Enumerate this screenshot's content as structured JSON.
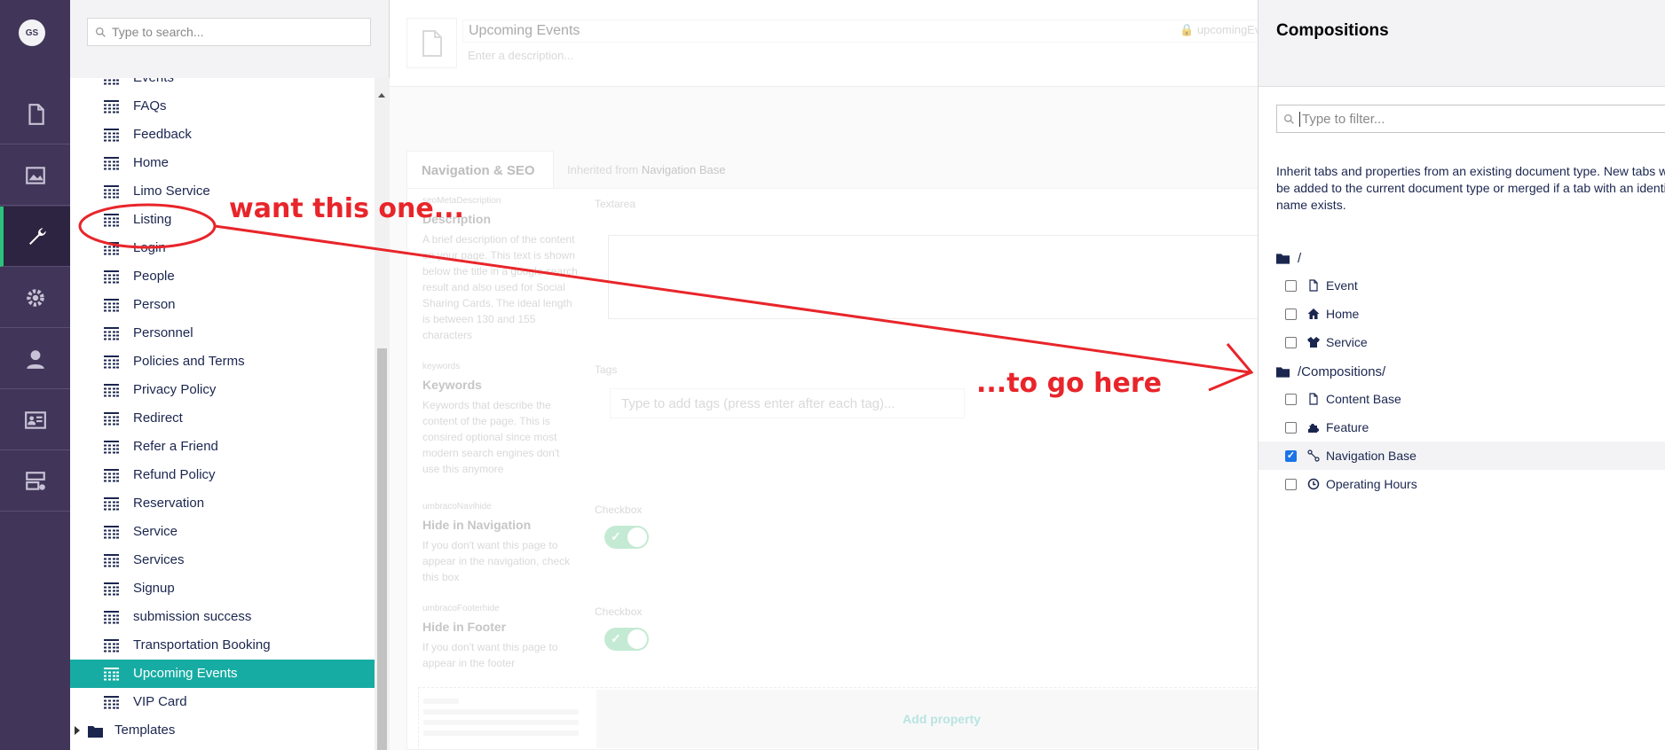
{
  "rail": {
    "avatar_initials": "GS",
    "sections": [
      {
        "name": "content",
        "icon": "document-icon"
      },
      {
        "name": "media",
        "icon": "image-icon"
      },
      {
        "name": "settings",
        "icon": "wrench-icon",
        "active": true
      },
      {
        "name": "packages",
        "icon": "gear-icon"
      },
      {
        "name": "users",
        "icon": "user-icon"
      },
      {
        "name": "members",
        "icon": "id-card-icon"
      },
      {
        "name": "forms",
        "icon": "form-icon"
      }
    ]
  },
  "tree": {
    "search_placeholder": "Type to search...",
    "partial_item": "Events",
    "items": [
      "FAQs",
      "Feedback",
      "Home",
      "Limo Service",
      "Listing",
      "Login",
      "People",
      "Person",
      "Personnel",
      "Policies and Terms",
      "Privacy Policy",
      "Redirect",
      "Refer a Friend",
      "Refund Policy",
      "Reservation",
      "Service",
      "Services",
      "Signup",
      "submission success",
      "Transportation Booking",
      "Upcoming Events",
      "VIP Card"
    ],
    "selected": "Upcoming Events",
    "folder": "Templates"
  },
  "editor": {
    "name": "Upcoming Events",
    "alias": "upcomingEve",
    "description_placeholder": "Enter a description...",
    "tab": "Navigation & SEO",
    "inherited_prefix": "Inherited from",
    "inherited_from": "Navigation Base",
    "properties": [
      {
        "alias": "seoMetaDescription",
        "name": "Description",
        "desc": "A brief description of the content on your page. This text is shown below the title in a google search result and also used for Social Sharing Cards. The ideal length is between 130 and 155 characters",
        "editor": "Textarea"
      },
      {
        "alias": "keywords",
        "name": "Keywords",
        "desc": "Keywords that describe the content of the page. This is consired optional since most modern search engines don't use this anymore",
        "editor": "Tags",
        "placeholder": "Type to add tags (press enter after each tag)..."
      },
      {
        "alias": "umbracoNavihide",
        "name": "Hide in Navigation",
        "desc": "If you don't want this page to appear in the navigation, check this box",
        "editor": "Checkbox"
      },
      {
        "alias": "umbracoFooterhide",
        "name": "Hide in Footer",
        "desc": "If you don't want this page to appear in the footer",
        "editor": "Checkbox"
      }
    ],
    "add_property": "Add property"
  },
  "compositions": {
    "title": "Compositions",
    "filter_placeholder": "Type to filter...",
    "description": "Inherit tabs and properties from an existing document type. New tabs will be added to the current document type or merged if a tab with an identical name exists.",
    "groups": [
      {
        "path": "/",
        "items": [
          {
            "name": "Event",
            "icon": "document-icon",
            "checked": false
          },
          {
            "name": "Home",
            "icon": "home-icon",
            "checked": false
          },
          {
            "name": "Service",
            "icon": "jacket-icon",
            "checked": false
          }
        ]
      },
      {
        "path": "/Compositions/",
        "items": [
          {
            "name": "Content Base",
            "icon": "document-icon",
            "checked": false
          },
          {
            "name": "Feature",
            "icon": "puzzle-icon",
            "checked": false
          },
          {
            "name": "Navigation Base",
            "icon": "link-icon",
            "checked": true
          },
          {
            "name": "Operating Hours",
            "icon": "clock-icon",
            "checked": false
          }
        ]
      }
    ]
  },
  "annotations": {
    "want": "want this one...",
    "go": "...to go here",
    "color": "#e8252a"
  }
}
